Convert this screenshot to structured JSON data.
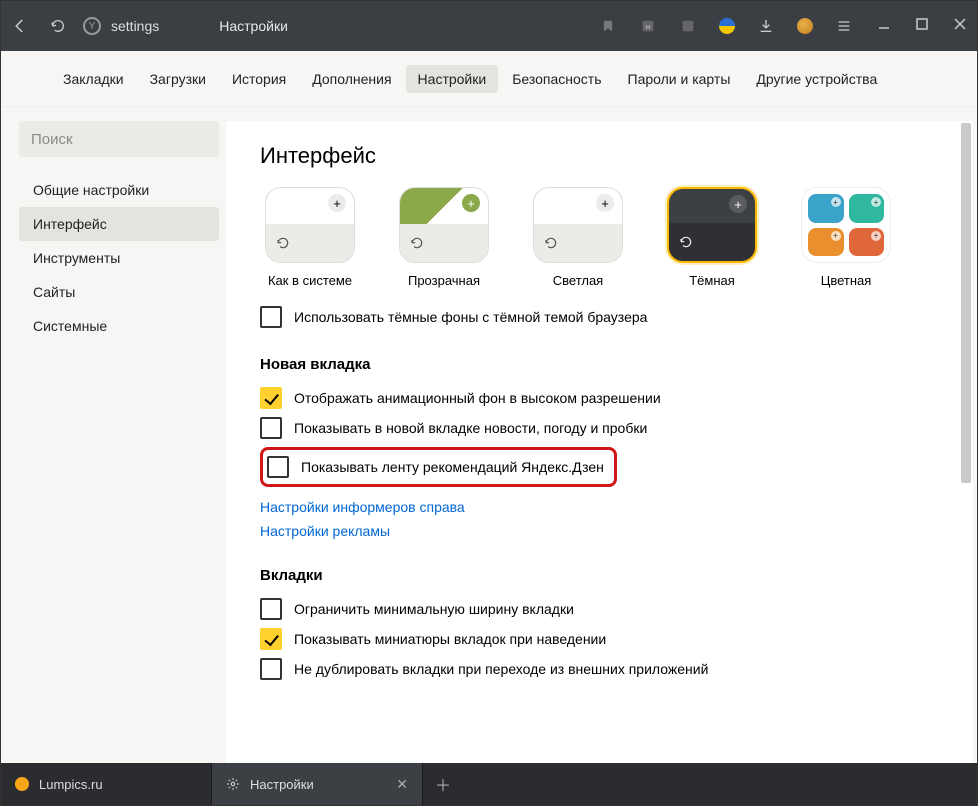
{
  "titlebar": {
    "address": "settings",
    "title": "Настройки"
  },
  "topnav": {
    "items": [
      "Закладки",
      "Загрузки",
      "История",
      "Дополнения",
      "Настройки",
      "Безопасность",
      "Пароли и карты",
      "Другие устройства"
    ],
    "active_index": 4
  },
  "sidebar": {
    "search_placeholder": "Поиск",
    "items": [
      "Общие настройки",
      "Интерфейс",
      "Инструменты",
      "Сайты",
      "Системные"
    ],
    "active_index": 1
  },
  "content": {
    "heading": "Интерфейс",
    "themes": [
      {
        "label": "Как в системе"
      },
      {
        "label": "Прозрачная"
      },
      {
        "label": "Светлая"
      },
      {
        "label": "Тёмная"
      },
      {
        "label": "Цветная"
      }
    ],
    "selected_theme_index": 3,
    "dark_backgrounds": {
      "label": "Использовать тёмные фоны с тёмной темой браузера",
      "checked": false
    },
    "section_new_tab": "Новая вкладка",
    "new_tab_options": [
      {
        "label": "Отображать анимационный фон в высоком разрешении",
        "checked": true
      },
      {
        "label": "Показывать в новой вкладке новости, погоду и пробки",
        "checked": false
      },
      {
        "label": "Показывать ленту рекомендаций Яндекс.Дзен",
        "checked": false,
        "highlight": true
      }
    ],
    "links": [
      "Настройки информеров справа",
      "Настройки рекламы"
    ],
    "section_tabs": "Вкладки",
    "tabs_options": [
      {
        "label": "Ограничить минимальную ширину вкладки",
        "checked": false
      },
      {
        "label": "Показывать миниатюры вкладок при наведении",
        "checked": true
      },
      {
        "label": "Не дублировать вкладки при переходе из внешних приложений",
        "checked": false
      }
    ]
  },
  "tabstrip": {
    "tabs": [
      {
        "label": "Lumpics.ru",
        "favicon": "#f7a61b"
      },
      {
        "label": "Настройки"
      }
    ],
    "active_index": 1
  }
}
